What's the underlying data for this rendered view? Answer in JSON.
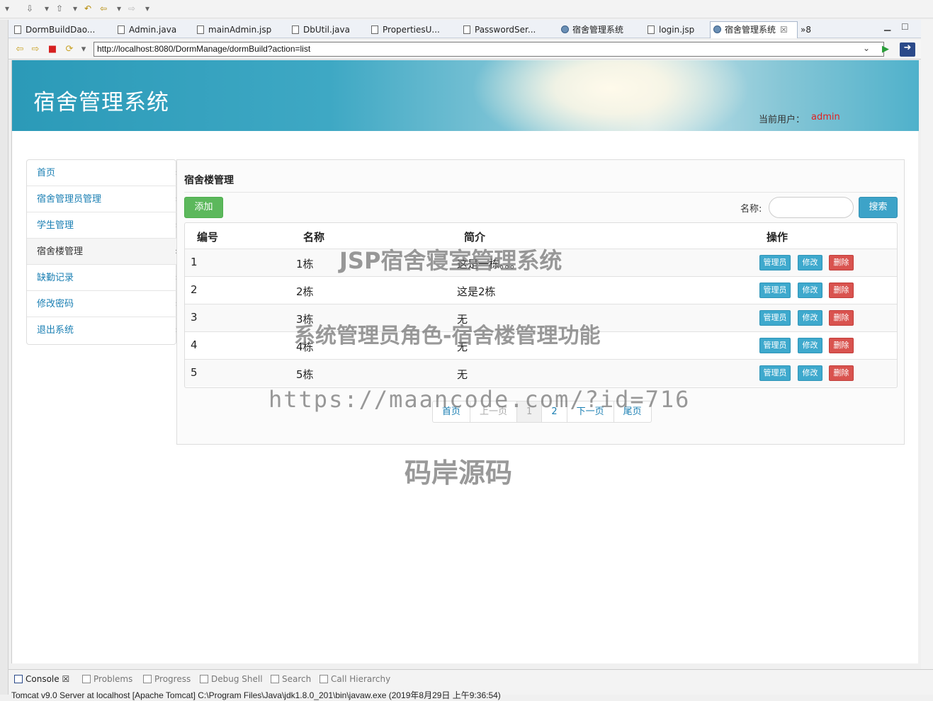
{
  "editor_tabs": [
    {
      "label": "DormBuildDao...",
      "icon": "java-file-icon"
    },
    {
      "label": "Admin.java",
      "icon": "java-file-icon"
    },
    {
      "label": "mainAdmin.jsp",
      "icon": "jsp-file-icon"
    },
    {
      "label": "DbUtil.java",
      "icon": "java-file-icon"
    },
    {
      "label": "PropertiesU...",
      "icon": "java-file-icon"
    },
    {
      "label": "PasswordSer...",
      "icon": "java-file-icon"
    },
    {
      "label": "宿舍管理系统",
      "icon": "browser-globe-icon"
    },
    {
      "label": "login.jsp",
      "icon": "jsp-file-icon"
    },
    {
      "label": "宿舍管理系统",
      "icon": "browser-globe-icon"
    }
  ],
  "tabs_overflow": "»8",
  "url": "http://localhost:8080/DormManage/dormBuild?action=list",
  "banner": {
    "title": "宿舍管理系统",
    "user_label": "当前用户：",
    "user_name": "admin"
  },
  "sidebar": {
    "items": [
      {
        "label": "首页"
      },
      {
        "label": "宿舍管理员管理"
      },
      {
        "label": "学生管理"
      },
      {
        "label": "宿舍楼管理",
        "active": true
      },
      {
        "label": "缺勤记录"
      },
      {
        "label": "修改密码"
      },
      {
        "label": "退出系统"
      }
    ]
  },
  "main": {
    "title": "宿舍楼管理",
    "add_label": "添加",
    "search_label": "名称:",
    "search_value": "",
    "search_button": "搜索"
  },
  "table": {
    "headers": [
      "编号",
      "名称",
      "简介",
      "操作"
    ],
    "rows": [
      {
        "id": "1",
        "name": "1栋",
        "desc": "这是一栋。。。"
      },
      {
        "id": "2",
        "name": "2栋",
        "desc": "这是2栋"
      },
      {
        "id": "3",
        "name": "3栋",
        "desc": "无"
      },
      {
        "id": "4",
        "name": "4栋",
        "desc": "无"
      },
      {
        "id": "5",
        "name": "5栋",
        "desc": "无"
      }
    ],
    "actions": {
      "manager": "管理员",
      "edit": "修改",
      "delete": "删除"
    }
  },
  "pagination": [
    "首页",
    "上一页",
    "1",
    "2",
    "下一页",
    "尾页"
  ],
  "watermarks": {
    "line1": "JSP宿舍寝室管理系统",
    "line2": "系统管理员角色-宿舍楼管理功能",
    "line3": "https://maancode.com/?id=716",
    "line4": "码岸源码"
  },
  "console_tabs": [
    "Console",
    "Problems",
    "Progress",
    "Debug Shell",
    "Search",
    "Call Hierarchy"
  ],
  "console_text": "Tomcat v9.0 Server at localhost [Apache Tomcat] C:\\Program Files\\Java\\jdk1.8.0_201\\bin\\javaw.exe (2019年8月29日 上午9:36:54)",
  "colors": {
    "accent": "#3ea9cd",
    "success": "#5cb85c",
    "danger": "#d9534f",
    "link": "#1a7fb3",
    "user": "#e02020"
  }
}
